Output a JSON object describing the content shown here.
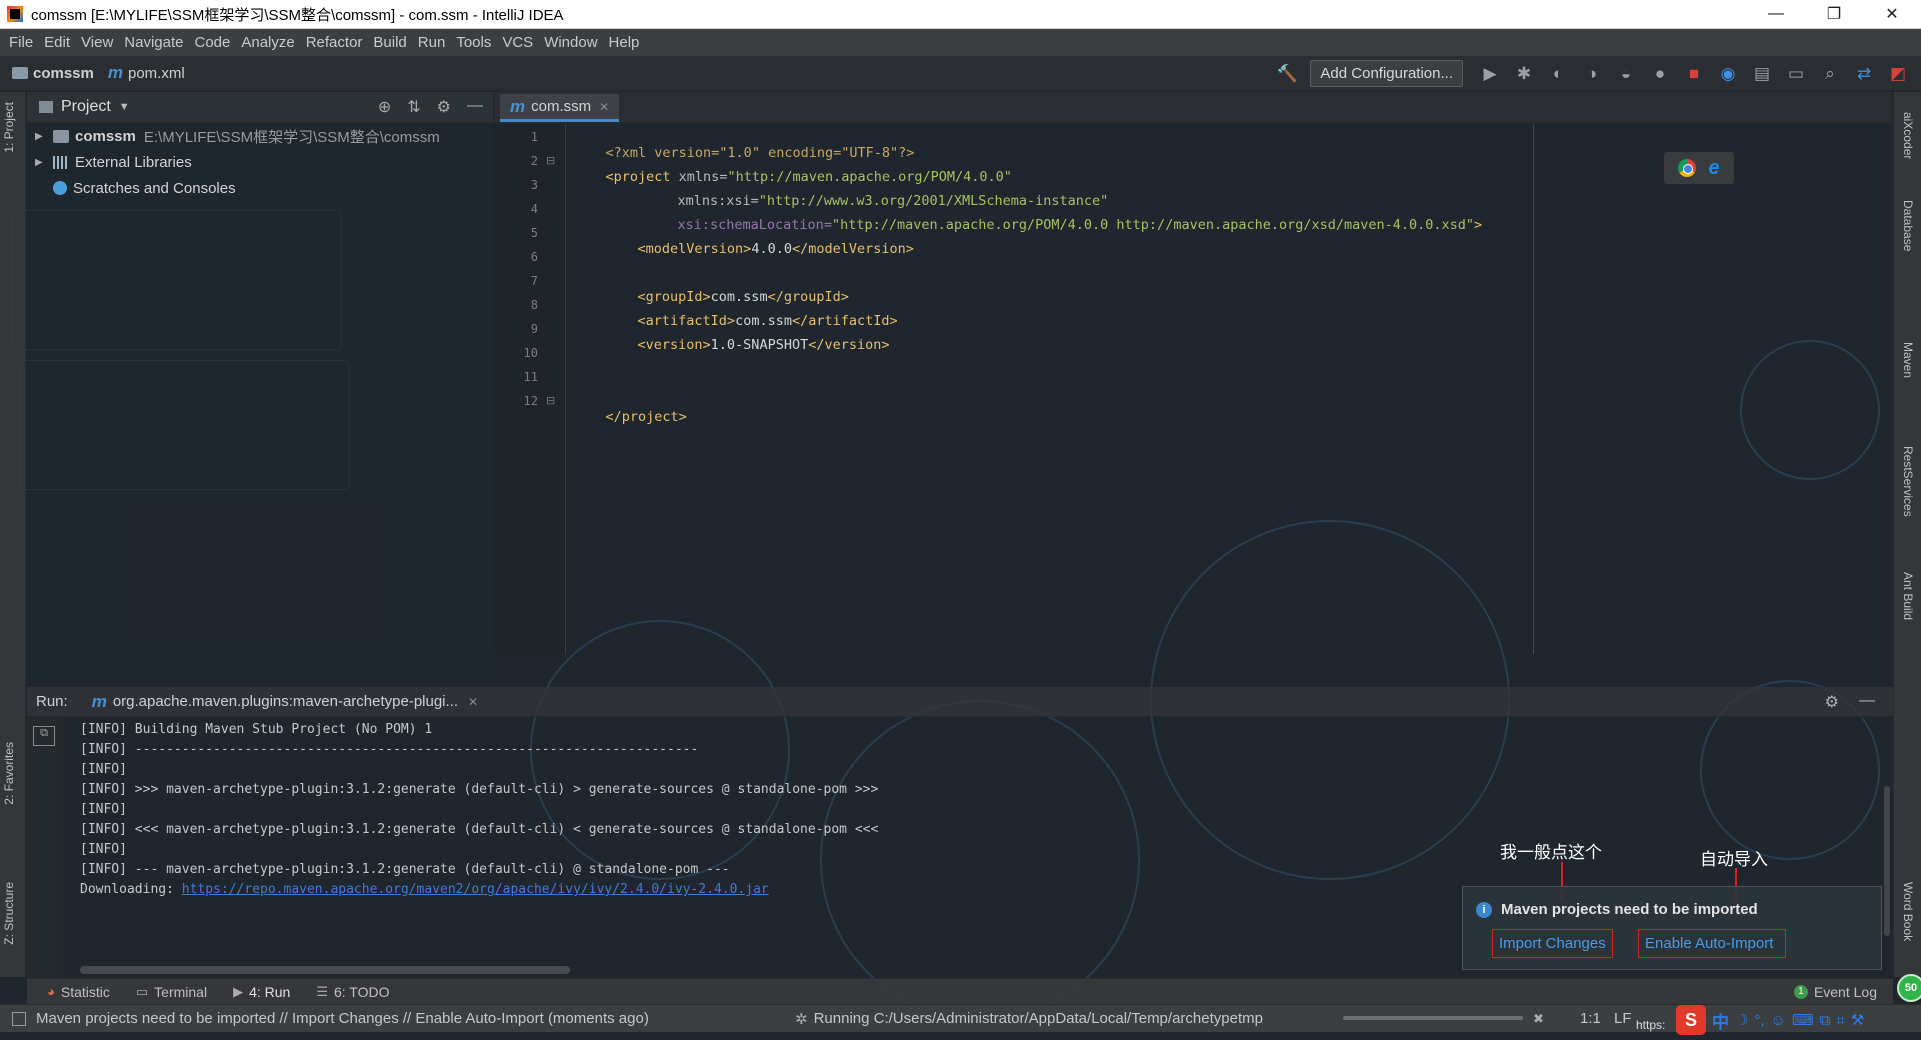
{
  "window": {
    "title": "comssm [E:\\MYLIFE\\SSM框架学习\\SSM整合\\comssm] - com.ssm - IntelliJ IDEA",
    "minimize": "—",
    "restore": "❐",
    "close": "✕"
  },
  "menu": [
    "File",
    "Edit",
    "View",
    "Navigate",
    "Code",
    "Analyze",
    "Refactor",
    "Build",
    "Run",
    "Tools",
    "VCS",
    "Window",
    "Help"
  ],
  "breadcrumb": {
    "project": "comssm",
    "file": "pom.xml"
  },
  "toolbar": {
    "add_configuration": "Add Configuration..."
  },
  "left_strip": {
    "project_tab": "1: Project",
    "favorites_tab": "2: Favorites",
    "structure_tab": "Z: Structure"
  },
  "right_strip": {
    "tabs": [
      "aiXcoder",
      "Database",
      "Maven",
      "RestServices",
      "Ant Build",
      "Word Book"
    ]
  },
  "project_panel": {
    "title": "Project",
    "tree": [
      {
        "name": "comssm",
        "path": "E:\\MYLIFE\\SSM框架学习\\SSM整合\\comssm"
      },
      {
        "name": "External Libraries",
        "path": ""
      },
      {
        "name": "Scratches and Consoles",
        "path": ""
      }
    ]
  },
  "editor": {
    "tab": "com.ssm",
    "line_numbers": [
      "1",
      "2",
      "3",
      "4",
      "5",
      "6",
      "7",
      "8",
      "9",
      "10",
      "11",
      "12"
    ],
    "code": {
      "l1_decl": "<?xml version=\"1.0\" encoding=\"UTF-8\"?>",
      "l2_open": "<project",
      "l2_attr": " xmlns=",
      "l2_val": "\"http://maven.apache.org/POM/4.0.0\"",
      "l3_attr": "xmlns:xsi=",
      "l3_val": "\"http://www.w3.org/2001/XMLSchema-instance\"",
      "l4_attr": "xsi:schemaLocation=",
      "l4_val": "\"http://maven.apache.org/POM/4.0.0 http://maven.apache.org/xsd/maven-4.0.0.xsd\"",
      "l4_close": ">",
      "l5_open": "<modelVersion>",
      "l5_text": "4.0.0",
      "l5_close": "</modelVersion>",
      "l7_open": "<groupId>",
      "l7_text": "com.ssm",
      "l7_close": "</groupId>",
      "l8_open": "<artifactId>",
      "l8_text": "com.ssm",
      "l8_close": "</artifactId>",
      "l9_open": "<version>",
      "l9_text": "1.0-SNAPSHOT",
      "l9_close": "</version>",
      "l12_close": "</project>"
    }
  },
  "run_panel": {
    "label": "Run:",
    "tab": "org.apache.maven.plugins:maven-archetype-plugi...",
    "lines": [
      "[INFO] Building Maven Stub Project (No POM) 1",
      "[INFO] ------------------------------------------------------------------------",
      "[INFO]",
      "[INFO] >>> maven-archetype-plugin:3.1.2:generate (default-cli) > generate-sources @ standalone-pom >>>",
      "[INFO]",
      "[INFO] <<< maven-archetype-plugin:3.1.2:generate (default-cli) < generate-sources @ standalone-pom <<<",
      "[INFO]",
      "[INFO] --- maven-archetype-plugin:3.1.2:generate (default-cli) @ standalone-pom ---"
    ],
    "downloading_prefix": "Downloading: ",
    "downloading_url": "https://repo.maven.apache.org/maven2/org/apache/ivy/ivy/2.4.0/ivy-2.4.0.jar"
  },
  "notification": {
    "title": "Maven projects need to be imported",
    "import_changes": "Import Changes",
    "enable_auto_import": "Enable Auto-Import"
  },
  "annotations": {
    "left": "我一般点这个",
    "right": "自动导入"
  },
  "bottom_tabs": {
    "statistic": "Statistic",
    "terminal": "Terminal",
    "run": "4: Run",
    "todo": "6: TODO",
    "event_log": "Event Log"
  },
  "status": {
    "message": "Maven projects need to be imported // Import Changes // Enable Auto-Import (moments ago)",
    "running": "Running C:/Users/Administrator/AppData/Local/Temp/archetypetmp",
    "position": "1:1",
    "line_sep": "LF"
  },
  "tray": {
    "url_fragment": "https:",
    "ime": "中",
    "badge": "50"
  },
  "colors": {
    "accent": "#4a88c7",
    "tag": "#e8bf6a",
    "string": "#a5c261",
    "link": "#3b7ed8",
    "annotation_red": "#d92020"
  }
}
